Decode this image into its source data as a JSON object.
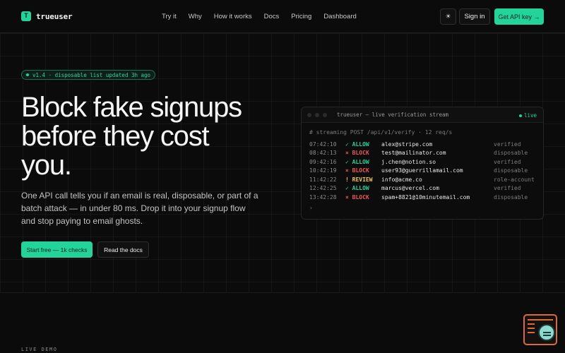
{
  "nav": {
    "logo_mark": "T",
    "brand": "trueuser",
    "links": [
      "Try it",
      "Why",
      "How it works",
      "Docs",
      "Pricing",
      "Dashboard"
    ],
    "theme_icon": "☀",
    "signin": "Sign in",
    "api_key": "Get API key →"
  },
  "hero": {
    "badge": "v1.4 · disposable list updated 3h ago",
    "title_lines": [
      "Block fake signups",
      "before they cost",
      "you."
    ],
    "subtitle": "One API call tells you if an email is real, disposable, or part of a batch attack — in under 80 ms. Drop it into your signup flow and stop paying to email ghosts.",
    "cta_primary": "Start free — 1k checks",
    "cta_secondary": "Read the docs"
  },
  "terminal": {
    "title": "trueuser — live verification stream",
    "live": "live",
    "command": "# streaming POST /api/v1/verify · 12 req/s",
    "rows": [
      {
        "time": "07:42:10",
        "status": "✓ ALLOW",
        "kind": "allow",
        "email": "alex@stripe.com",
        "tag": "verified"
      },
      {
        "time": "08:42:13",
        "status": "× BLOCK",
        "kind": "block",
        "email": "test@mailinator.com",
        "tag": "disposable"
      },
      {
        "time": "09:42:16",
        "status": "✓ ALLOW",
        "kind": "allow",
        "email": "j.chen@notion.so",
        "tag": "verified"
      },
      {
        "time": "10:42:19",
        "status": "× BLOCK",
        "kind": "block",
        "email": "user93@guerrillamail.com",
        "tag": "disposable"
      },
      {
        "time": "11:42:22",
        "status": "! REVIEW",
        "kind": "review",
        "email": "info@acme.co",
        "tag": "role-account"
      },
      {
        "time": "12:42:25",
        "status": "✓ ALLOW",
        "kind": "allow",
        "email": "marcus@vercel.com",
        "tag": "verified"
      },
      {
        "time": "13:42:28",
        "status": "× BLOCK",
        "kind": "block",
        "email": "spam+8821@10minutemail.com",
        "tag": "disposable"
      }
    ],
    "prompt": "›"
  },
  "section": {
    "label": "LIVE DEMO"
  },
  "colors": {
    "accent": "#22d39a",
    "block": "#ef5350",
    "review": "#f0c341",
    "background": "#0b0b0b"
  }
}
